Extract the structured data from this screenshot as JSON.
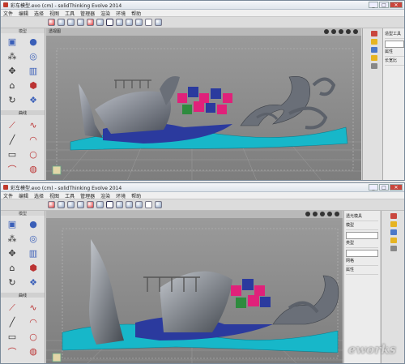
{
  "windows": [
    {
      "title": "彩车模型.evo (cm) - solidThinking Evolve 2014",
      "viewport_label": "透视图",
      "right_panel_title": "造型工具",
      "props": [
        "属性",
        "长宽比"
      ],
      "watermark": ""
    },
    {
      "title": "彩车模型.evo (cm) - solidThinking Evolve 2014",
      "viewport_label": "",
      "right_panel_title": "透光模具",
      "props": [
        "模型",
        "类型",
        "网格",
        "属性"
      ],
      "watermark": "eworks"
    }
  ],
  "menu": [
    "文件",
    "编辑",
    "选择",
    "视图",
    "工具",
    "管理器",
    "渲染",
    "环境",
    "帮助"
  ],
  "palette": {
    "top_header": "模型",
    "mid_header": "曲线"
  },
  "window_buttons": {
    "minimize": "_",
    "maximize": "□",
    "close": "✕"
  },
  "colors": {
    "viewport": "#8f8f8f",
    "sea": "#17b7c9",
    "hull": "#2b3a9e",
    "whale": "#6a6f78"
  }
}
